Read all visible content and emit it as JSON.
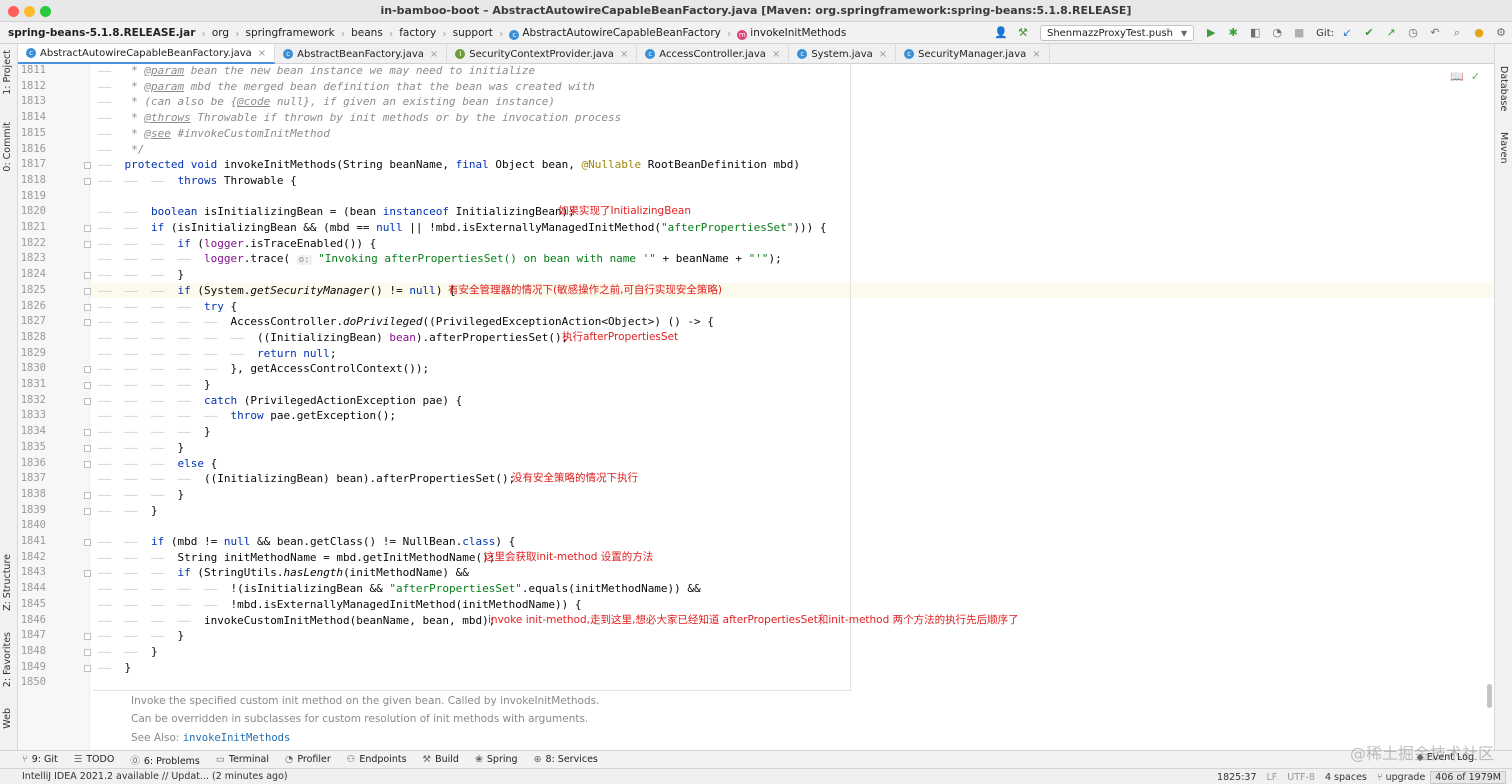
{
  "window": {
    "title": "in-bamboo-boot – AbstractAutowireCapableBeanFactory.java [Maven: org.springframework:spring-beans:5.1.8.RELEASE]"
  },
  "breadcrumb": [
    "spring-beans-5.1.8.RELEASE.jar",
    "org",
    "springframework",
    "beans",
    "factory",
    "support",
    "AbstractAutowireCapableBeanFactory",
    "invokeInitMethods"
  ],
  "toolbar": {
    "run_config": "ShenmazzProxyTest.push",
    "git_label": "Git:"
  },
  "tabs": [
    {
      "label": "AbstractAutowireCapableBeanFactory.java",
      "active": true,
      "icon": "class-icon"
    },
    {
      "label": "AbstractBeanFactory.java",
      "active": false,
      "icon": "class-icon"
    },
    {
      "label": "SecurityContextProvider.java",
      "active": false,
      "icon": "interface-icon"
    },
    {
      "label": "AccessController.java",
      "active": false,
      "icon": "class-icon"
    },
    {
      "label": "System.java",
      "active": false,
      "icon": "class-icon"
    },
    {
      "label": "SecurityManager.java",
      "active": false,
      "icon": "class-icon"
    }
  ],
  "left_tools": [
    "1: Project",
    "0: Commit",
    "Z: Structure",
    "2: Favorites",
    "Web"
  ],
  "right_tools": [
    "Database",
    "Maven"
  ],
  "editor": {
    "current_line_index": 14,
    "lines": [
      {
        "n": "1811",
        "indent": 1,
        "segs": [
          [
            "cmt",
            " * "
          ],
          [
            "cmt-tag",
            "@param"
          ],
          [
            "cmt",
            " bean the new bean instance we may need to initialize"
          ]
        ]
      },
      {
        "n": "1812",
        "indent": 1,
        "segs": [
          [
            "cmt",
            " * "
          ],
          [
            "cmt-tag",
            "@param"
          ],
          [
            "cmt",
            " mbd the merged bean definition that the bean was created with"
          ]
        ]
      },
      {
        "n": "1813",
        "indent": 1,
        "segs": [
          [
            "cmt",
            " * (can also be {"
          ],
          [
            "cmt-tag",
            "@code"
          ],
          [
            "cmt",
            " null}, if given an existing bean instance)"
          ]
        ]
      },
      {
        "n": "1814",
        "indent": 1,
        "segs": [
          [
            "cmt",
            " * "
          ],
          [
            "cmt-tag",
            "@throws"
          ],
          [
            "cmt",
            " Throwable if thrown by init methods or by the invocation process"
          ]
        ]
      },
      {
        "n": "1815",
        "indent": 1,
        "segs": [
          [
            "cmt",
            " * "
          ],
          [
            "cmt-tag",
            "@see"
          ],
          [
            "cmt",
            " #invokeCustomInitMethod"
          ]
        ]
      },
      {
        "n": "1816",
        "indent": 1,
        "segs": [
          [
            "cmt",
            " */"
          ]
        ]
      },
      {
        "n": "1817",
        "indent": 1,
        "segs": [
          [
            "kw",
            "protected void "
          ],
          [
            "",
            "invokeInitMethods(String beanName, "
          ],
          [
            "kw",
            "final "
          ],
          [
            "",
            "Object bean, "
          ],
          [
            "ann",
            "@Nullable "
          ],
          [
            "",
            "RootBeanDefinition mbd)"
          ]
        ]
      },
      {
        "n": "1818",
        "indent": 3,
        "segs": [
          [
            "kw",
            "throws "
          ],
          [
            "",
            "Throwable {"
          ]
        ]
      },
      {
        "n": "1819",
        "indent": 0,
        "segs": []
      },
      {
        "n": "1820",
        "indent": 2,
        "segs": [
          [
            "kw",
            "boolean "
          ],
          [
            "",
            "isInitializingBean = (bean "
          ],
          [
            "kw",
            "instanceof "
          ],
          [
            "",
            "InitializingBean);"
          ]
        ]
      },
      {
        "n": "1821",
        "indent": 2,
        "segs": [
          [
            "kw",
            "if "
          ],
          [
            "",
            "(isInitializingBean && (mbd == "
          ],
          [
            "kw",
            "null "
          ],
          [
            "",
            "|| !mbd.isExternallyManagedInitMethod("
          ],
          [
            "str",
            "\"afterPropertiesSet\""
          ],
          [
            "",
            "))) {"
          ]
        ]
      },
      {
        "n": "1822",
        "indent": 3,
        "segs": [
          [
            "kw",
            "if "
          ],
          [
            "",
            "("
          ],
          [
            "fld",
            "logger"
          ],
          [
            "",
            ".isTraceEnabled()) {"
          ]
        ]
      },
      {
        "n": "1823",
        "indent": 4,
        "segs": [
          [
            "fld",
            "logger"
          ],
          [
            "",
            ".trace( "
          ],
          [
            "hint",
            "o:"
          ],
          [
            "",
            " "
          ],
          [
            "str",
            "\"Invoking afterPropertiesSet() on bean with name '\""
          ],
          [
            "",
            " + beanName + "
          ],
          [
            "str",
            "\"'\""
          ],
          [
            "",
            ");"
          ]
        ]
      },
      {
        "n": "1824",
        "indent": 3,
        "segs": [
          [
            "",
            "}"
          ]
        ]
      },
      {
        "n": "1825",
        "indent": 3,
        "segs": [
          [
            "kw",
            "if "
          ],
          [
            "",
            "(System."
          ],
          [
            "it",
            "getSecurityManager"
          ],
          [
            "",
            "() != "
          ],
          [
            "kw",
            "null"
          ],
          [
            "",
            ") {"
          ]
        ]
      },
      {
        "n": "1826",
        "indent": 4,
        "segs": [
          [
            "kw",
            "try "
          ],
          [
            "",
            "{"
          ]
        ]
      },
      {
        "n": "1827",
        "indent": 5,
        "segs": [
          [
            "",
            "AccessController."
          ],
          [
            "it",
            "doPrivileged"
          ],
          [
            "",
            "((PrivilegedExceptionAction<Object>) () -> {"
          ]
        ]
      },
      {
        "n": "1828",
        "indent": 6,
        "segs": [
          [
            "",
            "((InitializingBean) "
          ],
          [
            "fld",
            "bean"
          ],
          [
            "",
            ").afterPropertiesSet();"
          ]
        ]
      },
      {
        "n": "1829",
        "indent": 6,
        "segs": [
          [
            "kw",
            "return null"
          ],
          [
            "",
            ";"
          ]
        ]
      },
      {
        "n": "1830",
        "indent": 5,
        "segs": [
          [
            "",
            "}, getAccessControlContext());"
          ]
        ]
      },
      {
        "n": "1831",
        "indent": 4,
        "segs": [
          [
            "",
            "}"
          ]
        ]
      },
      {
        "n": "1832",
        "indent": 4,
        "segs": [
          [
            "kw",
            "catch "
          ],
          [
            "",
            "(PrivilegedActionException pae) {"
          ]
        ]
      },
      {
        "n": "1833",
        "indent": 5,
        "segs": [
          [
            "kw",
            "throw "
          ],
          [
            "",
            "pae.getException();"
          ]
        ]
      },
      {
        "n": "1834",
        "indent": 4,
        "segs": [
          [
            "",
            "}"
          ]
        ]
      },
      {
        "n": "1835",
        "indent": 3,
        "segs": [
          [
            "",
            "}"
          ]
        ]
      },
      {
        "n": "1836",
        "indent": 3,
        "segs": [
          [
            "kw",
            "else "
          ],
          [
            "",
            "{"
          ]
        ]
      },
      {
        "n": "1837",
        "indent": 4,
        "segs": [
          [
            "",
            "((InitializingBean) bean).afterPropertiesSet();"
          ]
        ]
      },
      {
        "n": "1838",
        "indent": 3,
        "segs": [
          [
            "",
            "}"
          ]
        ]
      },
      {
        "n": "1839",
        "indent": 2,
        "segs": [
          [
            "",
            "}"
          ]
        ]
      },
      {
        "n": "1840",
        "indent": 0,
        "segs": []
      },
      {
        "n": "1841",
        "indent": 2,
        "segs": [
          [
            "kw",
            "if "
          ],
          [
            "",
            "(mbd != "
          ],
          [
            "kw",
            "null "
          ],
          [
            "",
            "&& bean.getClass() != NullBean."
          ],
          [
            "kw",
            "class"
          ],
          [
            "",
            ") {"
          ]
        ]
      },
      {
        "n": "1842",
        "indent": 3,
        "segs": [
          [
            "",
            "String initMethodName = mbd.getInitMethodName();"
          ]
        ]
      },
      {
        "n": "1843",
        "indent": 3,
        "segs": [
          [
            "kw",
            "if "
          ],
          [
            "",
            "(StringUtils."
          ],
          [
            "it",
            "hasLength"
          ],
          [
            "",
            "(initMethodName) &&"
          ]
        ]
      },
      {
        "n": "1844",
        "indent": 5,
        "segs": [
          [
            "",
            "!(isInitializingBean && "
          ],
          [
            "str",
            "\"afterPropertiesSet\""
          ],
          [
            "",
            ".equals(initMethodName)) &&"
          ]
        ]
      },
      {
        "n": "1845",
        "indent": 5,
        "segs": [
          [
            "",
            "!mbd.isExternallyManagedInitMethod(initMethodName)) {"
          ]
        ]
      },
      {
        "n": "1846",
        "indent": 4,
        "segs": [
          [
            "",
            "invokeCustomInitMethod(beanName, bean, mbd);"
          ]
        ]
      },
      {
        "n": "1847",
        "indent": 3,
        "segs": [
          [
            "",
            "}"
          ]
        ]
      },
      {
        "n": "1848",
        "indent": 2,
        "segs": [
          [
            "",
            "}"
          ]
        ]
      },
      {
        "n": "1849",
        "indent": 1,
        "segs": [
          [
            "",
            "}"
          ]
        ]
      },
      {
        "n": "1850",
        "indent": 0,
        "segs": []
      }
    ],
    "annotations": [
      {
        "line": 9,
        "text": "如果实现了InitializingBean",
        "col": 540
      },
      {
        "line": 14,
        "text": "有安全管理器的情况下(敏感操作之前,可自行实现安全策略)",
        "col": 430
      },
      {
        "line": 17,
        "text": "执行afterPropertiesSet",
        "col": 544
      },
      {
        "line": 26,
        "text": "没有安全策略的情况下执行",
        "col": 494
      },
      {
        "line": 31,
        "text": "这里会获取init-method 设置的方法",
        "col": 466
      },
      {
        "line": 35,
        "text": "invoke init-method,走到这里,想必大家已经知道  afterPropertiesSet和init-method 两个方法的执行先后顺序了",
        "col": 470
      }
    ]
  },
  "doc_popup": {
    "line1": "Invoke the specified custom init method on the given bean. Called by invokeInitMethods.",
    "line2": "Can be overridden in subclasses for custom resolution of init methods with arguments.",
    "see_also_label": "See Also:",
    "see_also_link": "invokeInitMethods"
  },
  "bottom_tools": [
    {
      "label": "9: Git",
      "icon": "git-icon"
    },
    {
      "label": "TODO",
      "icon": "todo-icon"
    },
    {
      "label": "6: Problems",
      "icon": "problems-icon"
    },
    {
      "label": "Terminal",
      "icon": "terminal-icon"
    },
    {
      "label": "Profiler",
      "icon": "profiler-icon"
    },
    {
      "label": "Endpoints",
      "icon": "endpoints-icon"
    },
    {
      "label": "Build",
      "icon": "build-icon"
    },
    {
      "label": "Spring",
      "icon": "spring-icon"
    },
    {
      "label": "8: Services",
      "icon": "services-icon"
    }
  ],
  "event_log": "Event Log",
  "watermark": "@稀土掘金技术社区",
  "status": {
    "message": "IntelliJ IDEA 2021.2 available // Updat... (2 minutes ago)",
    "position": "1825:37",
    "line_sep": "LF",
    "encoding": "UTF-8",
    "indent": "4 spaces",
    "branch": "upgrade",
    "memory": "406 of 1979M"
  }
}
